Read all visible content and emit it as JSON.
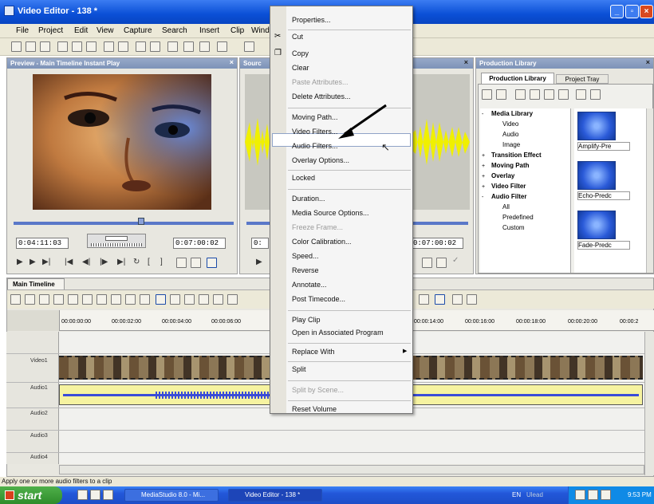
{
  "window": {
    "title": "Video Editor - 138 *"
  },
  "menu_bar": [
    "File",
    "Project",
    "Edit",
    "View",
    "Capture",
    "Search",
    "Insert",
    "Clip",
    "Wind"
  ],
  "preview_panel": {
    "title": "Preview - Main Timeline Instant Play",
    "start_time": "0:04:11:03",
    "end_time": "0:07:00:02"
  },
  "source_panel": {
    "title": "Sourc",
    "end_time": "0:07:00:02"
  },
  "library_panel": {
    "title": "Production Library",
    "tabs": [
      "Production Library",
      "Project Tray"
    ],
    "tree": [
      {
        "label": "Media Library",
        "expander": "-",
        "bold": true,
        "indent": 0
      },
      {
        "label": "Video",
        "expander": "",
        "bold": false,
        "indent": 2
      },
      {
        "label": "Audio",
        "expander": "",
        "bold": false,
        "indent": 2
      },
      {
        "label": "Image",
        "expander": "",
        "bold": false,
        "indent": 2
      },
      {
        "label": "Transition Effect",
        "expander": "+",
        "bold": true,
        "indent": 0
      },
      {
        "label": "Moving Path",
        "expander": "+",
        "bold": true,
        "indent": 0
      },
      {
        "label": "Overlay",
        "expander": "+",
        "bold": true,
        "indent": 0
      },
      {
        "label": "Video Filter",
        "expander": "+",
        "bold": true,
        "indent": 0
      },
      {
        "label": "Audio Filter",
        "expander": "-",
        "bold": true,
        "indent": 0
      },
      {
        "label": "All",
        "expander": "",
        "bold": false,
        "indent": 2
      },
      {
        "label": "Predefined",
        "expander": "",
        "bold": false,
        "indent": 2
      },
      {
        "label": "Custom",
        "expander": "",
        "bold": false,
        "indent": 2
      }
    ],
    "thumbnails": [
      "Amplify-Pre",
      "Echo-Predc",
      "Fade-Predc"
    ]
  },
  "context_menu": {
    "items": [
      {
        "label": "Properties...",
        "enabled": true,
        "sep_after": true
      },
      {
        "label": "Cut",
        "enabled": true,
        "icon": "scissors-icon"
      },
      {
        "label": "Copy",
        "enabled": true,
        "icon": "copy-icon"
      },
      {
        "label": "Clear",
        "enabled": true
      },
      {
        "label": "Paste Attributes...",
        "enabled": false
      },
      {
        "label": "Delete Attributes...",
        "enabled": true,
        "sep_after": true
      },
      {
        "label": "Moving Path...",
        "enabled": true
      },
      {
        "label": "Video Filters...",
        "enabled": true
      },
      {
        "label": "Audio Filters...",
        "enabled": true,
        "highlighted": true
      },
      {
        "label": "Overlay Options...",
        "enabled": true,
        "sep_after": true
      },
      {
        "label": "Locked",
        "enabled": true,
        "sep_after": true
      },
      {
        "label": "Duration...",
        "enabled": true
      },
      {
        "label": "Media Source Options...",
        "enabled": true
      },
      {
        "label": "Freeze Frame...",
        "enabled": false
      },
      {
        "label": "Color Calibration...",
        "enabled": true
      },
      {
        "label": "Speed...",
        "enabled": true
      },
      {
        "label": "Reverse",
        "enabled": true
      },
      {
        "label": "Annotate...",
        "enabled": true
      },
      {
        "label": "Post Timecode...",
        "enabled": true,
        "sep_after": true
      },
      {
        "label": "Play Clip",
        "enabled": true
      },
      {
        "label": "Open in Associated Program",
        "enabled": true,
        "sep_after": true
      },
      {
        "label": "Replace With",
        "enabled": true,
        "submenu": true,
        "sep_after": true
      },
      {
        "label": "Split",
        "enabled": true,
        "sep_after": true
      },
      {
        "label": "Split by Scene...",
        "enabled": false,
        "sep_after": true
      },
      {
        "label": "Reset Volume",
        "enabled": true
      }
    ]
  },
  "timeline": {
    "title": "Main Timeline",
    "ruler_left": [
      "00:00:00:00",
      "00:00:02:00",
      "00:00:04:00",
      "00:00:06:00"
    ],
    "ruler_right": [
      "00:00:14:00",
      "00:00:16:00",
      "00:00:18:00",
      "00:00:20:00",
      "00:00:2"
    ],
    "tracks": [
      "Video1",
      "Audio1",
      "Audio2",
      "Audio3",
      "Audio4"
    ]
  },
  "status_bar": {
    "text": "Apply one or more audio filters to a clip"
  },
  "taskbar": {
    "start_label": "start",
    "items": [
      "MediaStudio 8.0 - Mi...",
      "Video Editor - 138 *"
    ],
    "lang": "EN",
    "ulead": "Ulead",
    "clock": "9:53 PM"
  },
  "colors": {
    "title_blue": "#0a4fd6",
    "waveform_yellow": "#f0f000",
    "audio_wave_blue": "#3a4cd8",
    "start_green": "#3a9a35"
  }
}
